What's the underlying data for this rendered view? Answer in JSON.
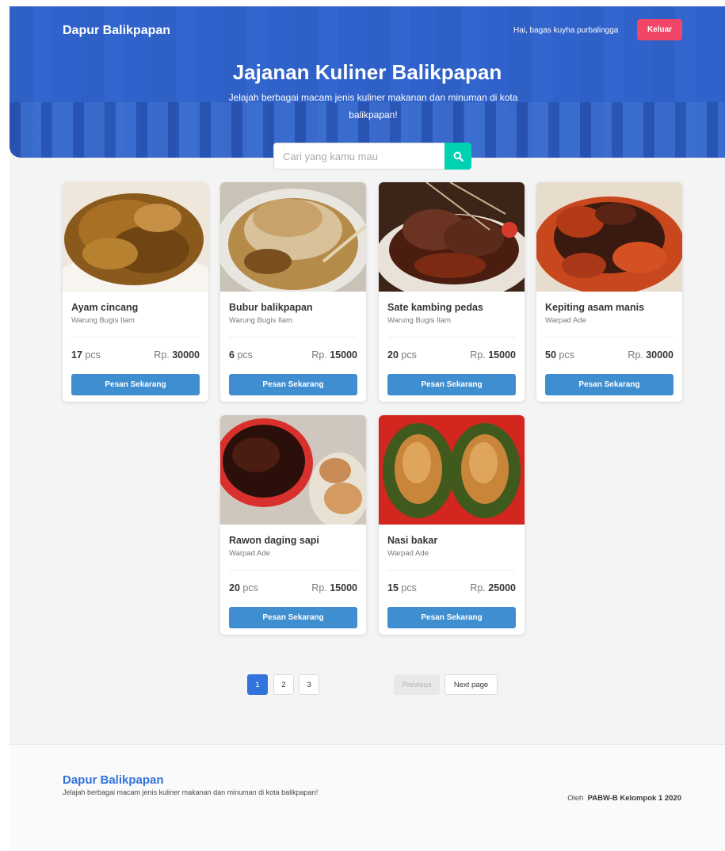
{
  "header": {
    "brand": "Dapur Balikpapan",
    "greeting": "Hai, bagas kuyha purbalingga",
    "logout_label": "Keluar"
  },
  "hero": {
    "title": "Jajanan Kuliner Balikpapan",
    "subtitle": "Jelajah berbagai macam jenis kuliner makanan dan minuman di kota balikpapan!"
  },
  "search": {
    "placeholder": "Cari yang kamu mau",
    "icon": "search-icon"
  },
  "products": [
    {
      "name": "Ayam cincang",
      "shop": "Warung Bugis Ilam",
      "qty": "17",
      "unit": "pcs",
      "currency": "Rp.",
      "price": "30000",
      "button": "Pesan Sekarang"
    },
    {
      "name": "Bubur balikpapan",
      "shop": "Warung Bugis Ilam",
      "qty": "6",
      "unit": "pcs",
      "currency": "Rp.",
      "price": "15000",
      "button": "Pesan Sekarang"
    },
    {
      "name": "Sate kambing pedas",
      "shop": "Warung Bugis Ilam",
      "qty": "20",
      "unit": "pcs",
      "currency": "Rp.",
      "price": "15000",
      "button": "Pesan Sekarang"
    },
    {
      "name": "Kepiting asam manis",
      "shop": "Warpad Ade",
      "qty": "50",
      "unit": "pcs",
      "currency": "Rp.",
      "price": "30000",
      "button": "Pesan Sekarang"
    },
    {
      "name": "Rawon daging sapi",
      "shop": "Warpad Ade",
      "qty": "20",
      "unit": "pcs",
      "currency": "Rp.",
      "price": "15000",
      "button": "Pesan Sekarang"
    },
    {
      "name": "Nasi bakar",
      "shop": "Warpad Ade",
      "qty": "15",
      "unit": "pcs",
      "currency": "Rp.",
      "price": "25000",
      "button": "Pesan Sekarang"
    }
  ],
  "pagination": {
    "pages": [
      "1",
      "2",
      "3"
    ],
    "current": "1",
    "previous": "Previous",
    "next": "Next page"
  },
  "footer": {
    "brand": "Dapur Balikpapan",
    "description": "Jelajah berbagai macam jenis kuliner makanan dan minuman di kota balikpapan!",
    "credit_prefix": "Oleh",
    "credit": "PABW-B Kelompok 1 2020"
  },
  "colors": {
    "hero": "#3064cd",
    "logout": "#f14668",
    "search_button": "#00d1b2",
    "order_button": "#3e8ed0",
    "page_active": "#3273dc"
  }
}
